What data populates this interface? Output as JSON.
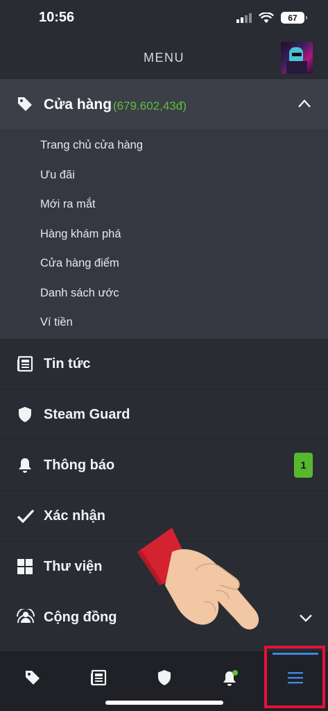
{
  "status_bar": {
    "time": "10:56",
    "battery": "67"
  },
  "header": {
    "title": "MENU"
  },
  "store": {
    "label": "Cửa hàng",
    "balance": "(679.602,43đ)",
    "expanded": true,
    "items": [
      {
        "label": "Trang chủ cửa hàng"
      },
      {
        "label": "Ưu đãi"
      },
      {
        "label": "Mới ra mắt"
      },
      {
        "label": "Hàng khám phá"
      },
      {
        "label": "Cửa hàng điểm"
      },
      {
        "label": "Danh sách ước"
      },
      {
        "label": "Ví tiền"
      }
    ]
  },
  "menu": {
    "items": [
      {
        "label": "Tin tức",
        "icon": "news-icon"
      },
      {
        "label": "Steam Guard",
        "icon": "shield-icon"
      },
      {
        "label": "Thông báo",
        "icon": "bell-icon",
        "badge": "1"
      },
      {
        "label": "Xác nhận",
        "icon": "checkmark-icon"
      },
      {
        "label": "Thư viện",
        "icon": "grid-icon"
      },
      {
        "label": "Cộng đồng",
        "icon": "community-icon"
      }
    ]
  },
  "bottom_nav": {
    "tabs": [
      "store-tag-icon",
      "news-icon",
      "shield-icon",
      "bell-icon",
      "menu-icon"
    ],
    "active": "menu-icon"
  },
  "colors": {
    "accent_green": "#5fbf3a",
    "badge_green": "#57b82f",
    "active_blue": "#3d8be0",
    "highlight_red": "#e2123a"
  }
}
